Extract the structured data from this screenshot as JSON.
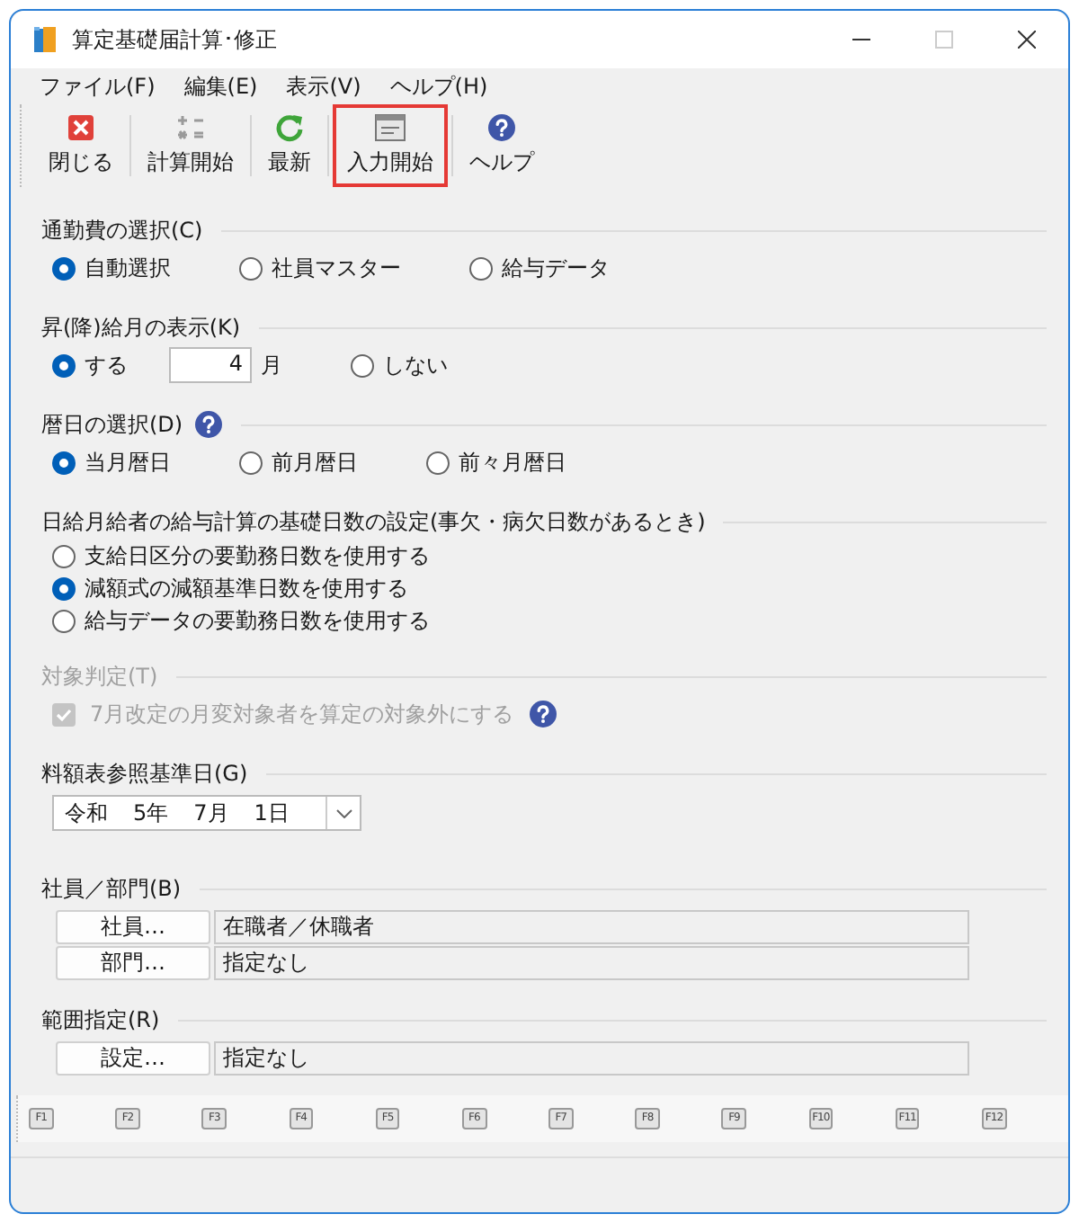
{
  "window": {
    "title": "算定基礎届計算･修正"
  },
  "menu": [
    "ファイル(F)",
    "編集(E)",
    "表示(V)",
    "ヘルプ(H)"
  ],
  "toolbar": [
    {
      "label": "閉じる",
      "highlighted": false
    },
    {
      "label": "計算開始",
      "highlighted": false
    },
    {
      "label": "最新",
      "highlighted": false
    },
    {
      "label": "入力開始",
      "highlighted": true
    },
    {
      "label": "ヘルプ",
      "highlighted": false
    }
  ],
  "sections": [
    {
      "title": "通勤費の選択(C)",
      "kind": "radio-row",
      "options": [
        {
          "label": "自動選択",
          "selected": true
        },
        {
          "label": "社員マスター",
          "selected": false
        },
        {
          "label": "給与データ",
          "selected": false
        }
      ]
    },
    {
      "title": "昇(降)給月の表示(K)",
      "kind": "radio-row",
      "options": [
        {
          "label": "する",
          "selected": true,
          "field": {
            "value": "4",
            "unit": "月"
          }
        },
        {
          "label": "しない",
          "selected": false
        }
      ]
    },
    {
      "title": "暦日の選択(D)",
      "kind": "radio-row",
      "help": true,
      "options": [
        {
          "label": "当月暦日",
          "selected": true
        },
        {
          "label": "前月暦日",
          "selected": false
        },
        {
          "label": "前々月暦日",
          "selected": false
        }
      ]
    },
    {
      "title": "日給月給者の給与計算の基礎日数の設定(事欠・病欠日数があるとき)",
      "kind": "radio-column",
      "options": [
        {
          "label": "支給日区分の要勤務日数を使用する",
          "selected": false
        },
        {
          "label": "減額式の減額基準日数を使用する",
          "selected": true
        },
        {
          "label": "給与データの要勤務日数を使用する",
          "selected": false
        }
      ]
    },
    {
      "title": "対象判定(T)",
      "kind": "checkbox",
      "disabled": true,
      "checkbox": {
        "label": "7月改定の月変対象者を算定の対象外にする",
        "checked": true,
        "help": true
      }
    },
    {
      "title": "料額表参照基準日(G)",
      "kind": "date",
      "date": {
        "era": "令和",
        "year": "5年",
        "month": "7月",
        "day": "1日"
      }
    },
    {
      "title": "社員／部門(B)",
      "kind": "pickers",
      "rows": [
        {
          "button": "社員…",
          "value": "在職者／休職者"
        },
        {
          "button": "部門…",
          "value": "指定なし"
        }
      ]
    },
    {
      "title": "範囲指定(R)",
      "kind": "pickers",
      "rows": [
        {
          "button": "設定…",
          "value": "指定なし"
        }
      ]
    }
  ],
  "function_keys": [
    "F1",
    "F2",
    "F3",
    "F4",
    "F5",
    "F6",
    "F7",
    "F8",
    "F9",
    "F10",
    "F11",
    "F12"
  ]
}
